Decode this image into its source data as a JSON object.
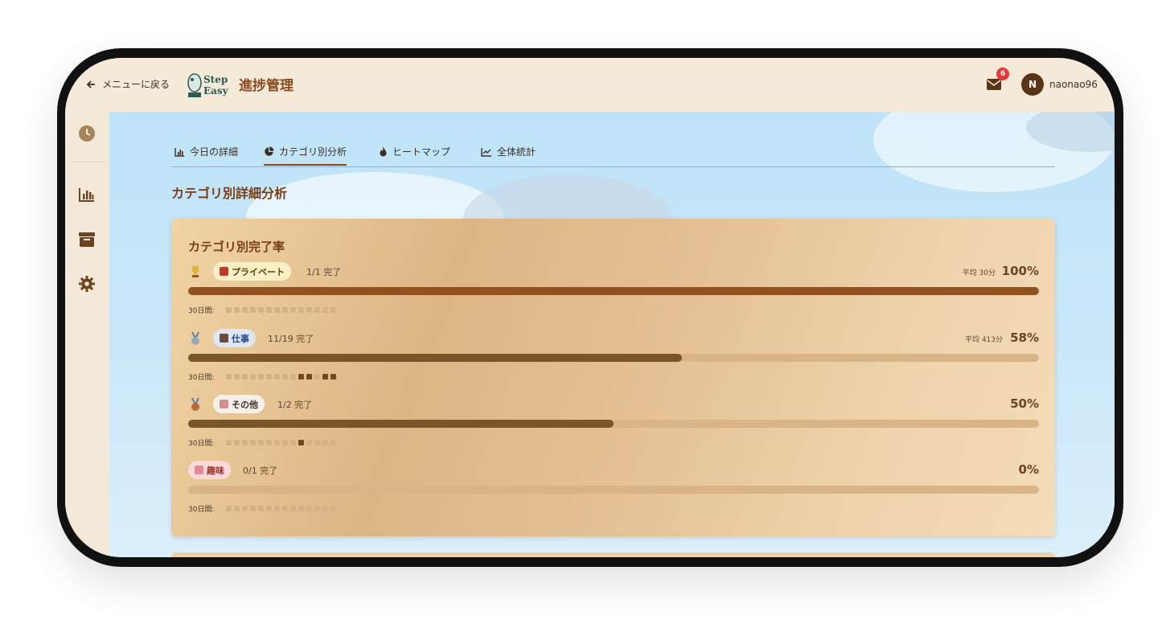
{
  "header": {
    "back_label": "メニューに戻る",
    "logo_text_1": "Step",
    "logo_text_2": "Easy",
    "title": "進捗管理",
    "mail_badge": "6",
    "avatar_initial": "N",
    "username": "naonao96"
  },
  "sidebar": {
    "items": [
      {
        "icon": "clock-icon"
      },
      {
        "icon": "bar-chart-icon"
      },
      {
        "icon": "archive-icon"
      },
      {
        "icon": "gear-icon"
      }
    ]
  },
  "tabs": [
    {
      "label": "今日の詳細",
      "icon": "bar-chart-icon",
      "active": false
    },
    {
      "label": "カテゴリ別分析",
      "icon": "pie-chart-icon",
      "active": true
    },
    {
      "label": "ヒートマップ",
      "icon": "flame-icon",
      "active": false
    },
    {
      "label": "全体統計",
      "icon": "trend-chart-icon",
      "active": false
    }
  ],
  "section_title": "カテゴリ別詳細分析",
  "card": {
    "title": "カテゴリ別完了率",
    "days_label": "30日間:",
    "categories": [
      {
        "medal": "gold-trophy-icon",
        "name": "プライベート",
        "chip_bg": "#fbefc6",
        "chip_fg": "#5a3c10",
        "icon_color": "#c0392b",
        "count": "1/1 完了",
        "avg": "平均 30分",
        "percent_label": "100%",
        "percent": 100,
        "fill_color": "#93511f",
        "days": [
          0,
          0,
          0,
          0,
          0,
          0,
          0,
          0,
          0,
          0,
          0,
          0,
          0,
          0
        ]
      },
      {
        "medal": "silver-medal-icon",
        "name": "仕事",
        "chip_bg": "#dfe6f3",
        "chip_fg": "#2a4a8a",
        "icon_color": "#6a4a3a",
        "count": "11/19 完了",
        "avg": "平均 413分",
        "percent_label": "58%",
        "percent": 58,
        "fill_color": "#7a5528",
        "days": [
          0,
          0,
          0,
          0,
          0,
          0,
          0,
          0,
          0,
          1,
          1,
          0,
          1,
          1
        ]
      },
      {
        "medal": "bronze-medal-icon",
        "name": "その他",
        "chip_bg": "#f6f0ea",
        "chip_fg": "#3c3024",
        "icon_color": "#d98a8a",
        "count": "1/2 完了",
        "avg": "",
        "percent_label": "50%",
        "percent": 50,
        "fill_color": "#7a5528",
        "days": [
          0,
          0,
          0,
          0,
          0,
          0,
          0,
          0,
          0,
          1,
          0,
          0,
          0,
          0
        ]
      },
      {
        "medal": "",
        "name": "趣味",
        "chip_bg": "#fbd9d9",
        "chip_fg": "#a0301e",
        "icon_color": "#e08a9a",
        "count": "0/1 完了",
        "avg": "",
        "percent_label": "0%",
        "percent": 0,
        "fill_color": "#7a5528",
        "days": [
          0,
          0,
          0,
          0,
          0,
          0,
          0,
          0,
          0,
          0,
          0,
          0,
          0,
          0
        ]
      }
    ]
  }
}
